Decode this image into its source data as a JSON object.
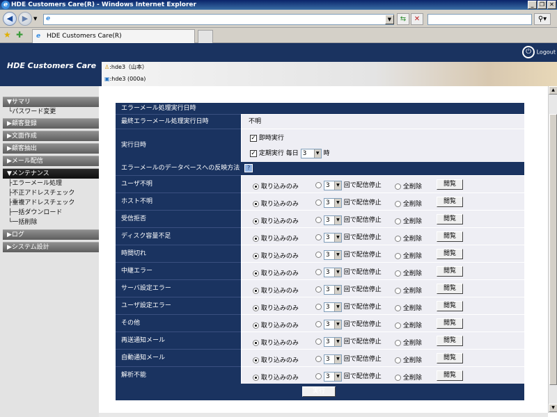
{
  "window": {
    "title": "HDE Customers Care(R) - Windows Internet Explorer"
  },
  "tab": {
    "label": "HDE Customers Care(R)"
  },
  "header": {
    "logo": "HDE Customers Care",
    "user1": ":hde3（山本）",
    "user2": ":hde3 (000a)",
    "logout": "Logout"
  },
  "sidebar": {
    "sections": [
      {
        "label": "▼サマリ",
        "subs": [
          "└パスワード変更"
        ]
      },
      {
        "label": "▶顧客登録"
      },
      {
        "label": "▶文面作成"
      },
      {
        "label": "▶顧客抽出"
      },
      {
        "label": "▶メール配信"
      },
      {
        "label": "▼メンテナンス",
        "subs": [
          "├エラーメール処理",
          "├不正アドレスチェック",
          "├重複アドレスチェック",
          "├一括ダウンロード",
          "└一括削除"
        ]
      },
      {
        "label": "▶ログ"
      },
      {
        "label": "▶システム設計"
      }
    ]
  },
  "main": {
    "section1_title": "エラーメール処理実行日時",
    "last_exec_label": "最終エラーメール処理実行日時",
    "last_exec_value": "不明",
    "exec_label": "実行日時",
    "immediate_label": "即時実行",
    "scheduled_label": "定期実行",
    "daily_label": "毎日",
    "hour_value": "3",
    "hour_suffix": "時",
    "section2_title": "エラーメールのデータベースへの反映方法",
    "opt_import_only": "取り込みのみ",
    "opt_stop_suffix": "回で配信停止",
    "opt_delete_all": "全削除",
    "view_button": "閲覧",
    "count_value": "3",
    "rows": [
      "ユーザ不明",
      "ホスト不明",
      "受信拒否",
      "ディスク容量不足",
      "時間切れ",
      "中継エラー",
      "サーバ設定エラー",
      "ユーザ設定エラー",
      "その他",
      "再送通知メール",
      "自動通知メール",
      "解析不能"
    ],
    "submit_button": "実行"
  }
}
